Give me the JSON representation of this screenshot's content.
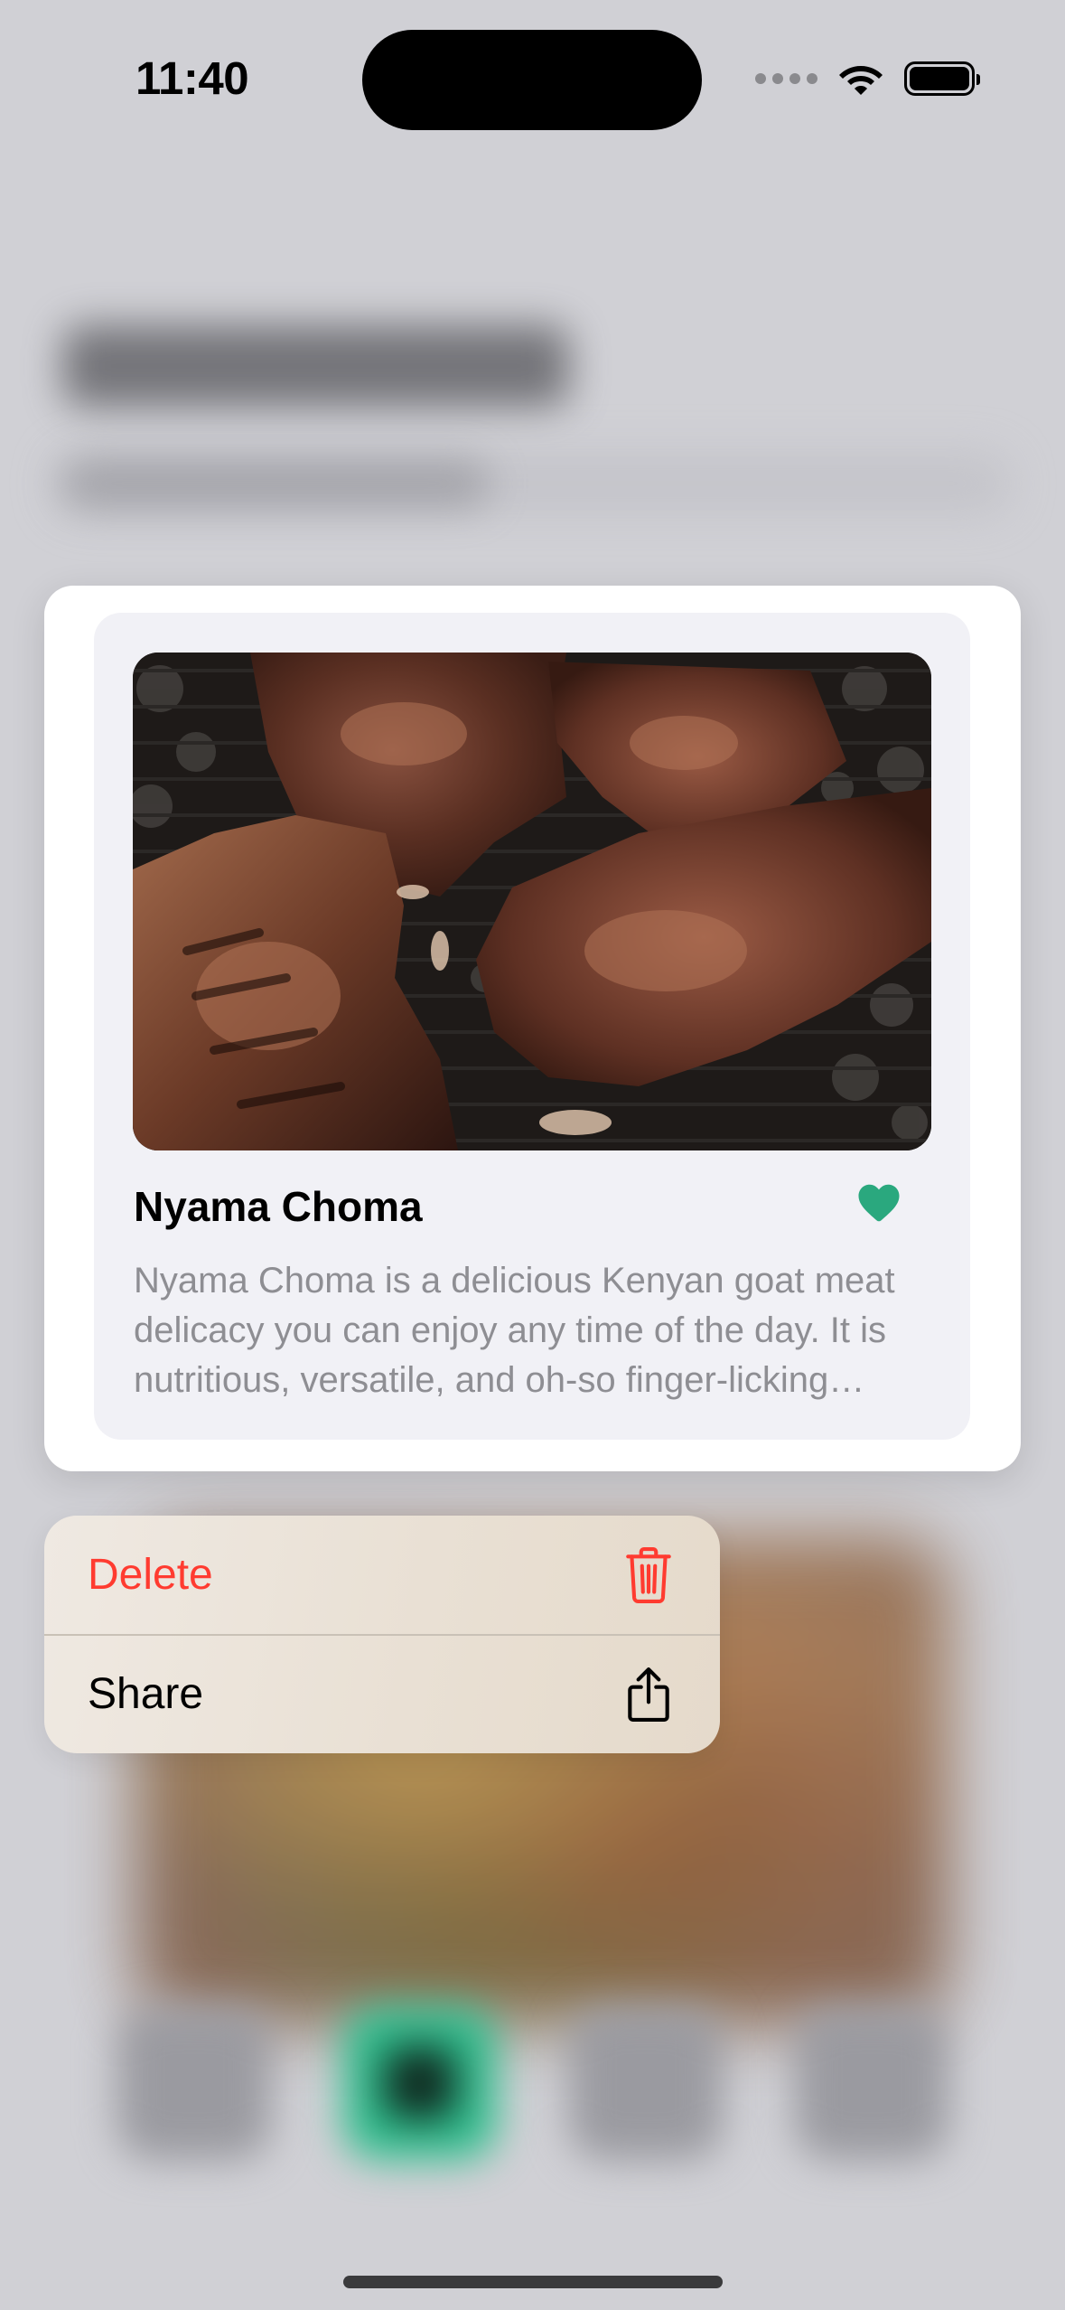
{
  "status_bar": {
    "time": "11:40",
    "icons": [
      "cellular-signal-icon",
      "wifi-icon",
      "battery-icon"
    ]
  },
  "recipe_card": {
    "image_icon": "grilled-meat-photo",
    "title": "Nyama Choma",
    "favorite_icon": "heart-icon",
    "favorite_color": "#2aa87e",
    "description": "Nyama Choma is a delicious Kenyan goat meat delicacy you can enjoy any time of the day. It is nutritious, versatile, and oh-so finger-licking…"
  },
  "context_menu": {
    "items": [
      {
        "label": "Delete",
        "icon": "trash-icon",
        "color": "#ff3b30"
      },
      {
        "label": "Share",
        "icon": "share-icon",
        "color": "#000000"
      }
    ]
  }
}
